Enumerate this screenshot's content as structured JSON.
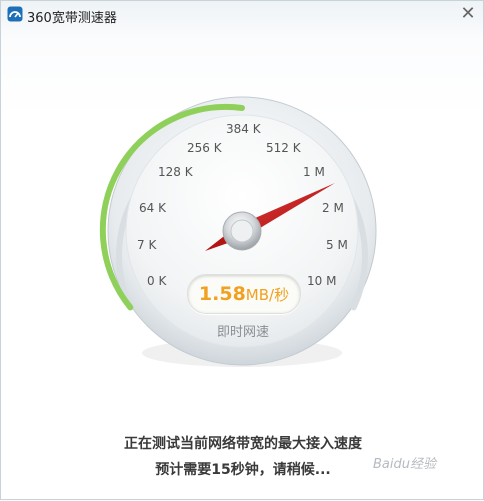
{
  "window": {
    "title": "360宽带测速器",
    "close_icon": "close-icon",
    "app_icon": "speedometer-app-icon"
  },
  "gauge": {
    "scale_labels": [
      "0 K",
      "7 K",
      "64 K",
      "128 K",
      "256 K",
      "384 K",
      "512 K",
      "1 M",
      "2 M",
      "5 M",
      "10 M"
    ],
    "current_speed_value": "1.58",
    "current_speed_unit": "MB/秒",
    "caption": "即时网速",
    "progress_color": "#8fd05a",
    "needle_color": "#cc1f1f",
    "speed_color": "#f2a01f"
  },
  "status": {
    "line1": "正在测试当前网络带宽的最大接入速度",
    "line2": "预计需要15秒钟，请稍候..."
  },
  "watermark": {
    "text": "Baidu经验"
  }
}
